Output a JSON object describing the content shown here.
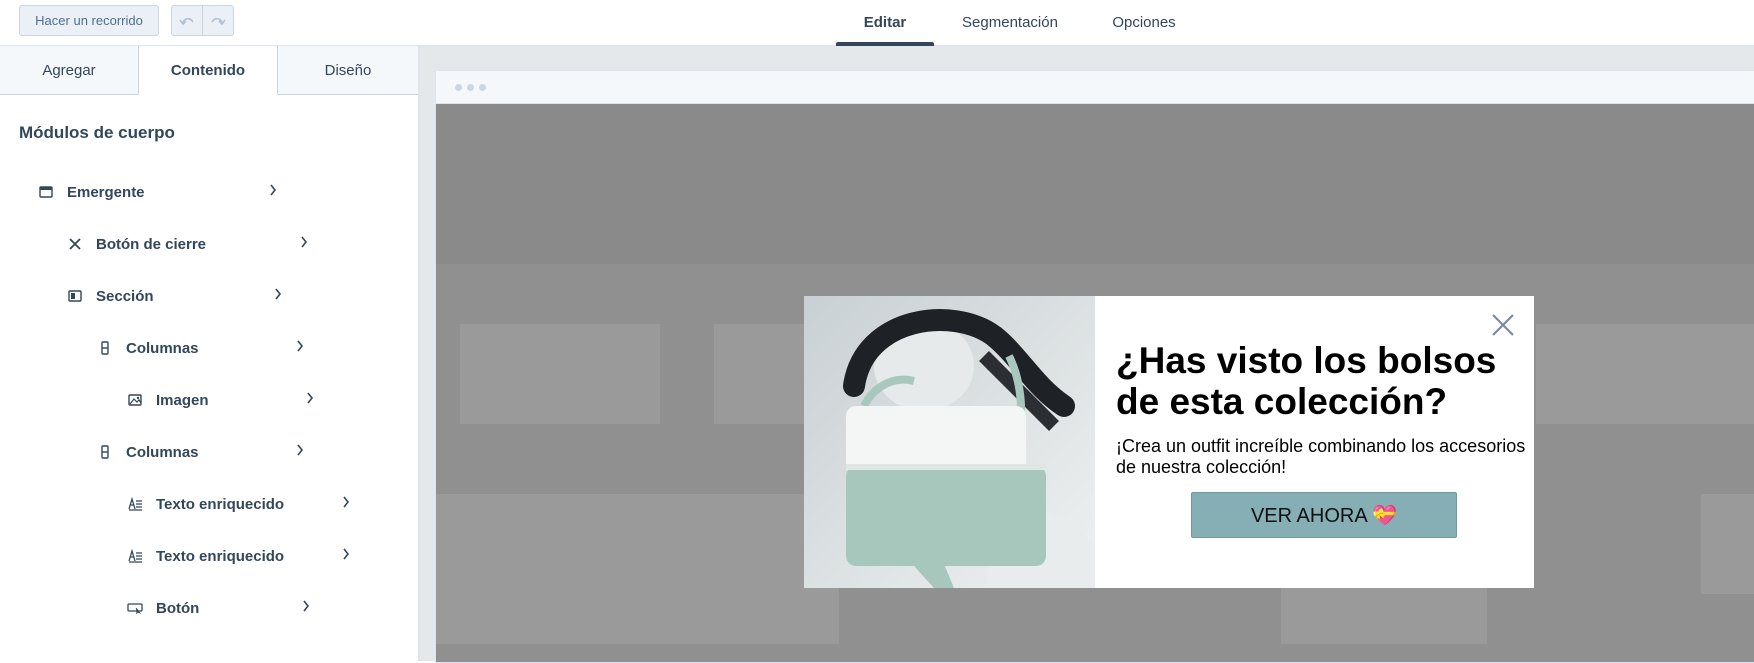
{
  "toolbar": {
    "tour_label": "Hacer un recorrido",
    "undo_icon": "undo-icon",
    "redo_icon": "redo-icon"
  },
  "top_tabs": [
    {
      "label": "Editar",
      "active": true
    },
    {
      "label": "Segmentación",
      "active": false
    },
    {
      "label": "Opciones",
      "active": false
    }
  ],
  "sidebar": {
    "tabs": [
      {
        "label": "Agregar",
        "active": false
      },
      {
        "label": "Contenido",
        "active": true
      },
      {
        "label": "Diseño",
        "active": false
      }
    ],
    "title": "Módulos de cuerpo",
    "tree": [
      {
        "label": "Emergente",
        "icon": "window-icon",
        "level": 0
      },
      {
        "label": "Botón de cierre",
        "icon": "close-icon",
        "level": 1
      },
      {
        "label": "Sección",
        "icon": "section-icon",
        "level": 1
      },
      {
        "label": "Columnas",
        "icon": "columns-icon",
        "level": 2
      },
      {
        "label": "Imagen",
        "icon": "image-icon",
        "level": 3
      },
      {
        "label": "Columnas",
        "icon": "columns-icon",
        "level": 2
      },
      {
        "label": "Texto enriquecido",
        "icon": "rich-text-icon",
        "level": 3
      },
      {
        "label": "Texto enriquecido",
        "icon": "rich-text-icon",
        "level": 3
      },
      {
        "label": "Botón",
        "icon": "button-icon",
        "level": 3
      }
    ]
  },
  "popup": {
    "title": "¿Has visto los bolsos de esta colección?",
    "text": "¡Crea un outfit increíble combinando los accesorios de nuestra colección!",
    "cta_label": "VER AHORA 💝",
    "cta_color": "#86aeb5"
  },
  "colors": {
    "text": "#33475b",
    "overlay": "#909090",
    "accent": "#33475b"
  }
}
